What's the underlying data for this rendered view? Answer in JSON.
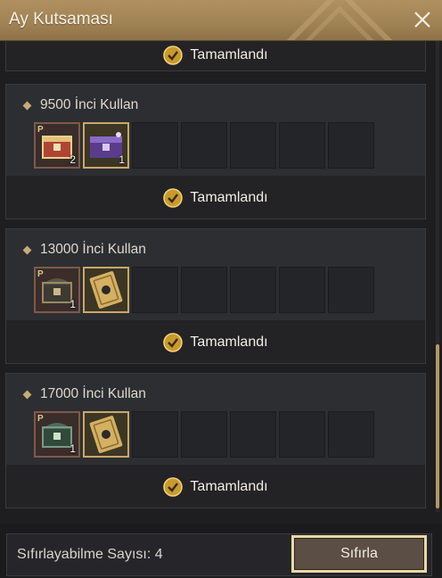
{
  "window": {
    "title": "Ay Kutsaması"
  },
  "colors": {
    "accent": "#b09060",
    "panel": "#2d2e32",
    "gold_border": "#c9a86a",
    "check": "#e2b43a"
  },
  "top_partial": {
    "status": "Tamamlandı"
  },
  "missions": [
    {
      "title": "9500 İnci Kullan",
      "status": "Tamamlandı",
      "rewards": [
        {
          "icon": "red-treasure-chest-icon",
          "qty": "2",
          "p": "P"
        },
        {
          "icon": "purple-treasure-chest-icon",
          "qty": "1",
          "p": ""
        }
      ]
    },
    {
      "title": "13000 İnci Kullan",
      "status": "Tamamlandı",
      "rewards": [
        {
          "icon": "dark-treasure-chest-icon",
          "qty": "1",
          "p": "P"
        },
        {
          "icon": "gold-ticket-icon",
          "qty": "",
          "p": ""
        }
      ]
    },
    {
      "title": "17000 İnci Kullan",
      "status": "Tamamlandı",
      "rewards": [
        {
          "icon": "green-treasure-chest-icon",
          "qty": "1",
          "p": "P"
        },
        {
          "icon": "gold-ticket-icon",
          "qty": "",
          "p": ""
        }
      ]
    }
  ],
  "footer": {
    "reset_count_label": "Sıfırlayabilme Sayısı: 4",
    "reset_button": "Sıfırla"
  }
}
